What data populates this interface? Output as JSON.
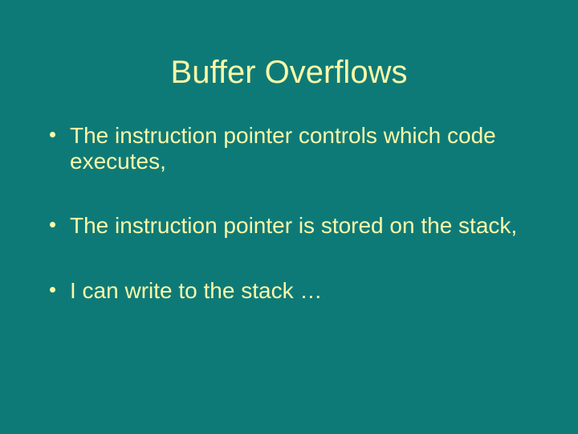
{
  "slide": {
    "title": "Buffer Overflows",
    "bullets": [
      "The instruction pointer controls which code executes,",
      "The instruction pointer is stored on the stack,",
      "I can write to the stack …"
    ]
  }
}
